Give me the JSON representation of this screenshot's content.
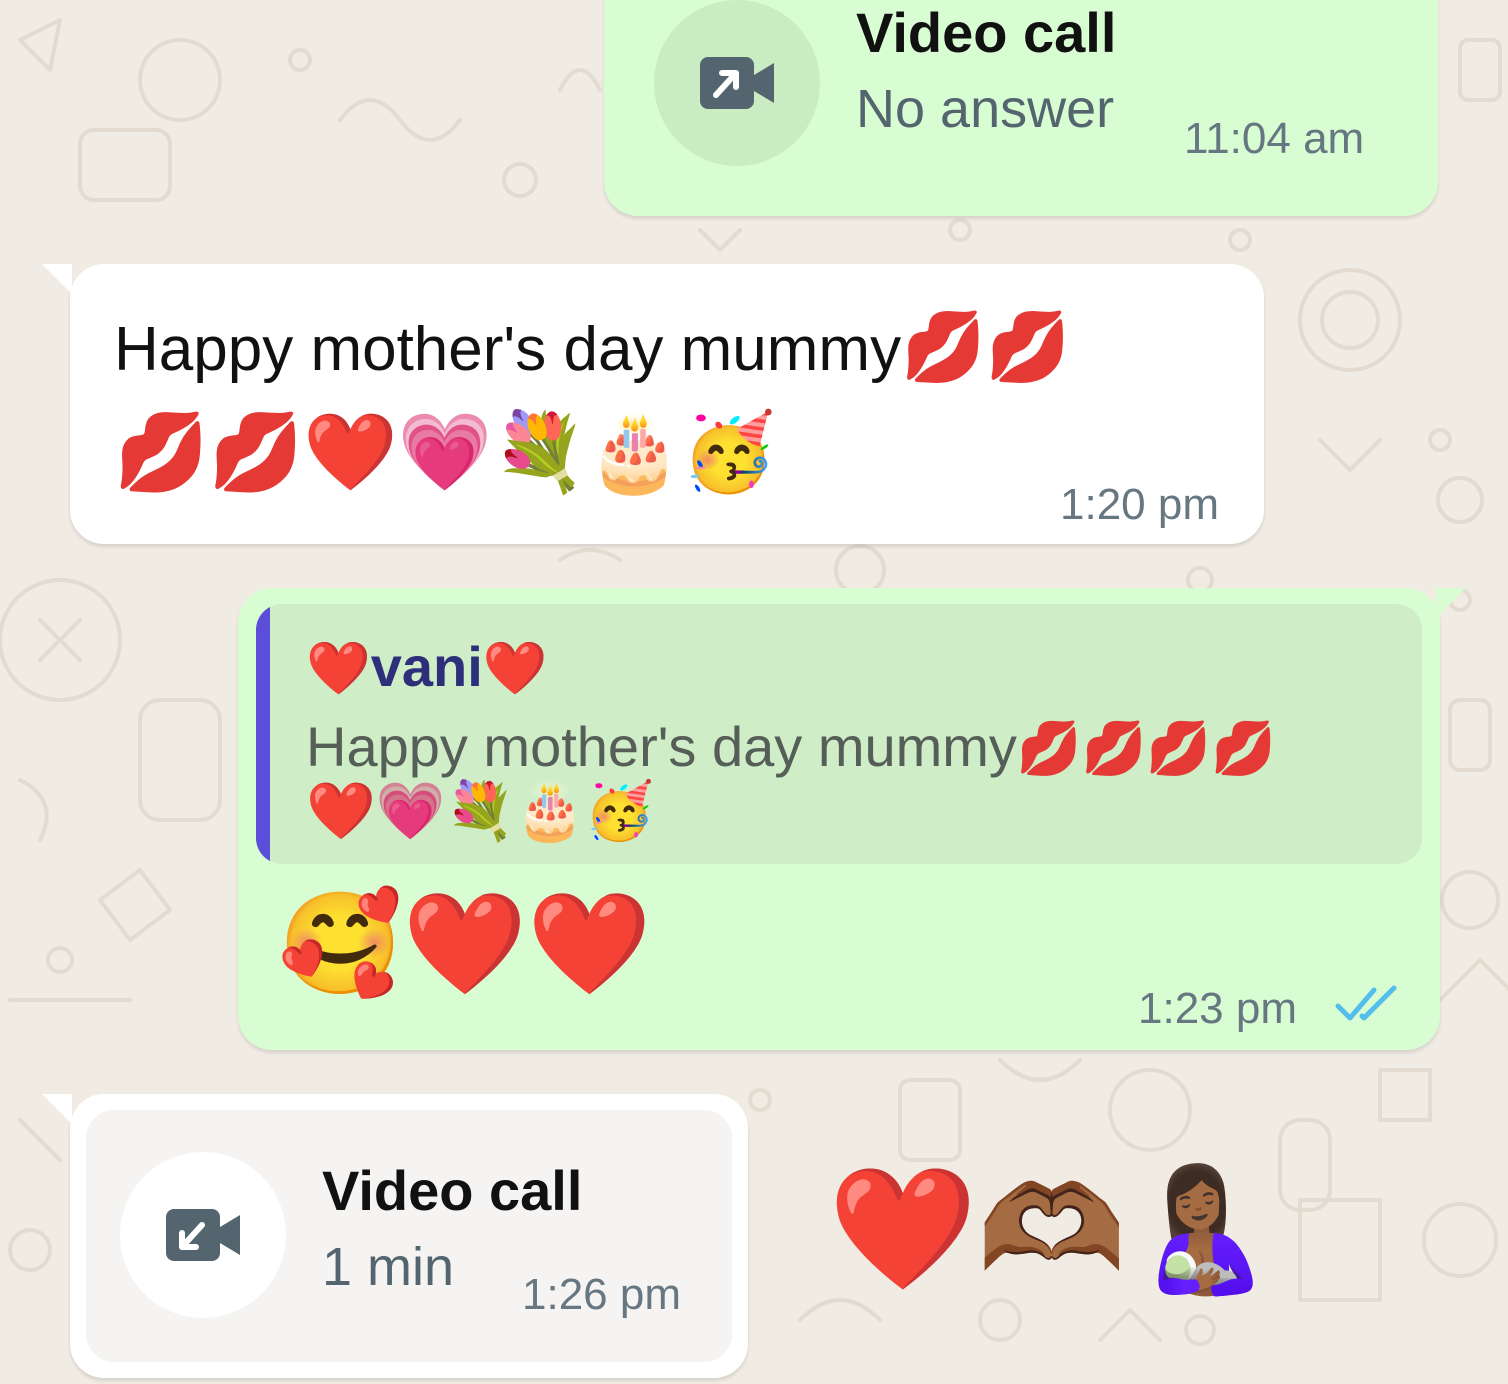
{
  "colors": {
    "outgoing_bubble": "#d9fdd3",
    "incoming_bubble": "#ffffff",
    "read_ticks": "#53bdeb",
    "quote_bar": "#5b4fd9"
  },
  "messages": {
    "call_outgoing": {
      "icon": "video-call-outgoing-icon",
      "title": "Video call",
      "status": "No answer",
      "time": "11:04 am"
    },
    "incoming_text": {
      "text": "Happy mother's day mummy",
      "emoji_line1": "💋💋",
      "emoji_line2": "💋💋❤️💗💐🎂🥳",
      "time": "1:20 pm"
    },
    "outgoing_reply": {
      "quote_author_prefix": "❤️",
      "quote_author": "vani",
      "quote_author_suffix": "❤️",
      "quote_text": "Happy mother's day mummy",
      "quote_emoji_line1": "💋💋💋💋",
      "quote_emoji_line2": "❤️💗💐🎂🥳",
      "reply_emojis": "🥰❤️❤️",
      "time": "1:23 pm",
      "status": "read-ticks-icon"
    },
    "call_incoming": {
      "icon": "video-call-incoming-icon",
      "title": "Video call",
      "duration": "1 min",
      "time": "1:26 pm"
    },
    "standalone_emojis": "❤️🫶🏾🤱🏾"
  }
}
